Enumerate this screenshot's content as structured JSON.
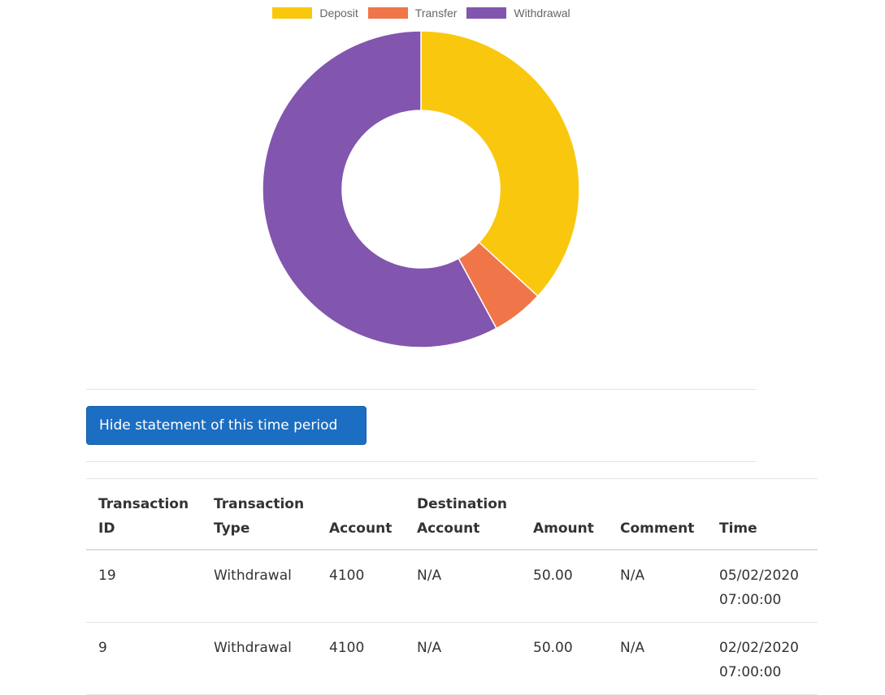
{
  "chart_data": {
    "type": "pie",
    "variant": "doughnut",
    "legend_position": "top",
    "series": [
      {
        "name": "Deposit",
        "value": 36.8,
        "color": "#f9c80e"
      },
      {
        "name": "Transfer",
        "value": 5.3,
        "color": "#f0764a"
      },
      {
        "name": "Withdrawal",
        "value": 57.9,
        "color": "#8255ae"
      }
    ]
  },
  "actions": {
    "toggle_label": "Hide statement of this time period"
  },
  "table": {
    "headers": [
      "Transaction ID",
      "Transaction Type",
      "Account",
      "Destination Account",
      "Amount",
      "Comment",
      "Time"
    ],
    "rows": [
      [
        "19",
        "Withdrawal",
        "4100",
        "N/A",
        "50.00",
        "N/A",
        "05/02/2020 07:00:00"
      ],
      [
        "9",
        "Withdrawal",
        "4100",
        "N/A",
        "50.00",
        "N/A",
        "02/02/2020 07:00:00"
      ]
    ]
  }
}
